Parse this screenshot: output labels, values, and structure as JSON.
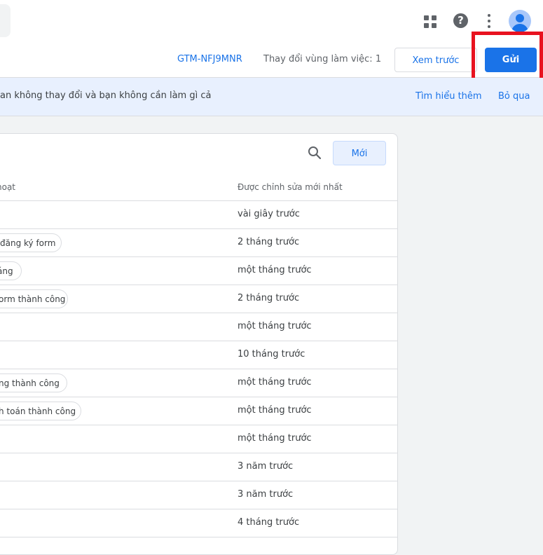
{
  "header": {
    "icons": [
      "apps-icon",
      "help-icon",
      "more-vert-icon",
      "account-avatar"
    ],
    "help_glyph": "?"
  },
  "toolbar": {
    "container_id": "GTM-NFJ9MNR",
    "workspace_changes": "Thay đổi vùng làm việc: 1",
    "preview_label": "Xem trước",
    "submit_label": "Gửi",
    "highlight_color": "#e8121f"
  },
  "banner": {
    "text": "an không thay đổi và bạn không cần làm gì cả",
    "learn_more": "Tìm hiểu thêm",
    "dismiss": "Bỏ qua"
  },
  "card": {
    "new_button": "Mới",
    "columns": {
      "trigger": "hoạt",
      "last_edited": "Được chỉnh sửa mới nhất"
    },
    "rows": [
      {
        "trigger": "",
        "edited": "vài giây trước"
      },
      {
        "trigger": "đăng ký form",
        "edited": "2 tháng trước"
      },
      {
        "trigger": "áng",
        "edited": "một tháng trước"
      },
      {
        "trigger": "orm thành công",
        "edited": "2 tháng trước"
      },
      {
        "trigger": "",
        "edited": "một tháng trước"
      },
      {
        "trigger": "",
        "edited": "10 tháng trước"
      },
      {
        "trigger": "ng thành công",
        "edited": "một tháng trước"
      },
      {
        "trigger": "h toán thành công",
        "edited": "một tháng trước"
      },
      {
        "trigger": "",
        "edited": "một tháng trước"
      },
      {
        "trigger": "",
        "edited": "3 năm trước"
      },
      {
        "trigger": "",
        "edited": "3 năm trước"
      },
      {
        "trigger": "",
        "edited": "4 tháng trước"
      }
    ]
  }
}
